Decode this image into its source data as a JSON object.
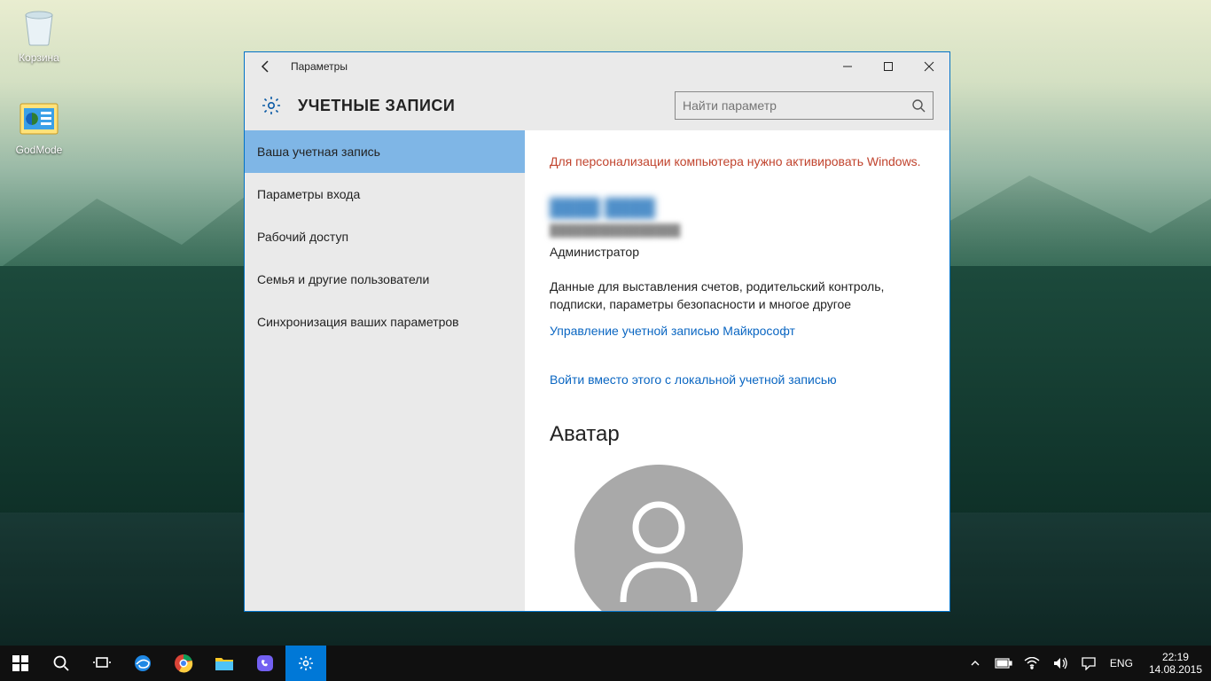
{
  "desktop": {
    "icons": [
      {
        "name": "recycle-bin",
        "label": "Корзина"
      },
      {
        "name": "godmode",
        "label": "GodMode"
      }
    ]
  },
  "window": {
    "title": "Параметры",
    "heading": "УЧЕТНЫЕ ЗАПИСИ",
    "search_placeholder": "Найти параметр",
    "sidebar": [
      "Ваша учетная запись",
      "Параметры входа",
      "Рабочий доступ",
      "Семья и другие пользователи",
      "Синхронизация ваших параметров"
    ],
    "sidebar_active_index": 0,
    "content": {
      "activation_warning": "Для персонализации компьютера нужно активировать Windows.",
      "user_name_blurred": "████ ████",
      "user_email_blurred": "████████████████",
      "user_role": "Администратор",
      "description": "Данные для выставления счетов, родительский контроль, подписки, параметры безопасности и многое другое",
      "manage_link": "Управление учетной записью Майкрософт",
      "local_signin_link": "Войти вместо этого с локальной учетной записью",
      "avatar_heading": "Аватар"
    }
  },
  "taskbar": {
    "lang": "ENG",
    "time": "22:19",
    "date": "14.08.2015"
  }
}
